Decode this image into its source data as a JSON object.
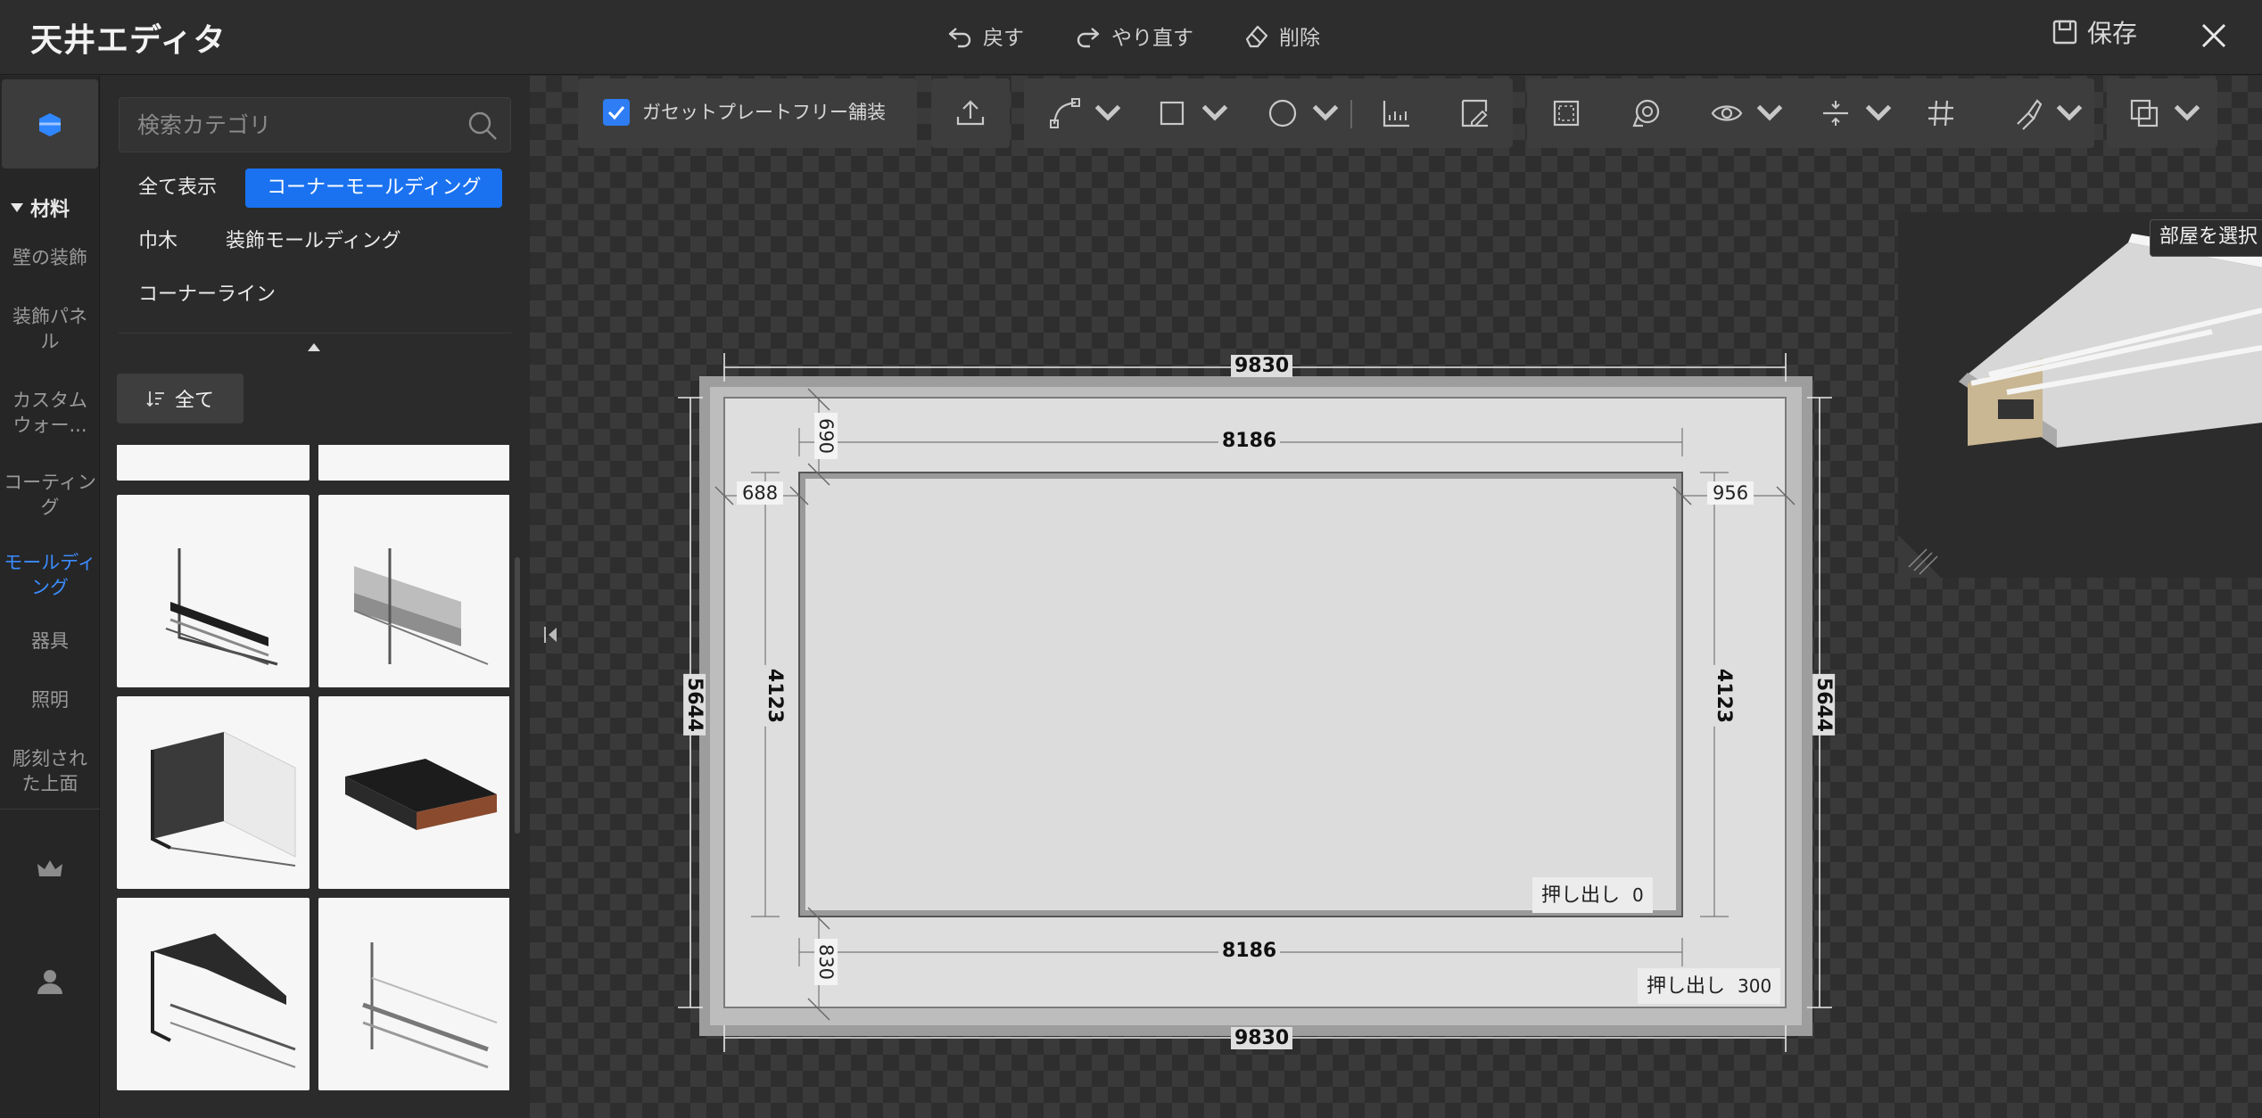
{
  "app": {
    "title": "天井エディタ"
  },
  "header": {
    "undo": "戻す",
    "redo": "やり直す",
    "delete": "削除",
    "save": "保存"
  },
  "rail": {
    "section": "材料",
    "items": [
      "壁の装飾",
      "装飾パネル",
      "カスタムウォー...",
      "コーティング",
      "モールディング",
      "器具",
      "照明",
      "彫刻された上面"
    ],
    "active": "モールディング"
  },
  "panel": {
    "search_placeholder": "検索カテゴリ",
    "categories": [
      "全て表示",
      "コーナーモールディング",
      "巾木",
      "装飾モールディング",
      "コーナーライン"
    ],
    "selected_category": "コーナーモールディング",
    "filter_label": "全て"
  },
  "toolbar": {
    "gasket_label": "ガセットプレートフリー舗装",
    "gasket_checked": true
  },
  "preview": {
    "select_room": "部屋を選択"
  },
  "drawing": {
    "outer_width": "9830",
    "outer_height": "5644",
    "inner_width": "8186",
    "inner_height": "4123",
    "top_gap": "690",
    "bottom_gap": "830",
    "left_gap": "688",
    "right_gap": "956",
    "inner_extrude_label": "押し出し",
    "inner_extrude_value": "0",
    "outer_extrude_label": "押し出し",
    "outer_extrude_value": "300"
  },
  "colors": {
    "accent": "#1a72f0",
    "active_text": "#3b8cff"
  }
}
